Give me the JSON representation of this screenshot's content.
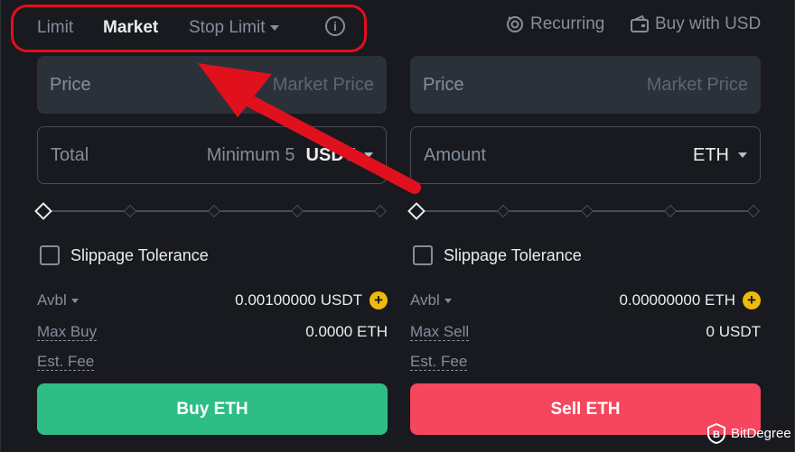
{
  "header": {
    "tabs": [
      {
        "label": "Limit",
        "active": false
      },
      {
        "label": "Market",
        "active": true
      },
      {
        "label": "Stop Limit",
        "active": false
      }
    ],
    "info_icon": "info-circle-icon",
    "recurring_label": "Recurring",
    "buy_with_usd_label": "Buy with USD"
  },
  "buy": {
    "price_label": "Price",
    "price_placeholder": "Market Price",
    "total_label": "Total",
    "total_min": "Minimum 5",
    "total_unit": "USDT",
    "slippage_label": "Slippage Tolerance",
    "avbl_label": "Avbl",
    "avbl_value": "0.00100000 USDT",
    "max_label": "Max Buy",
    "max_value": "0.0000 ETH",
    "fee_label": "Est. Fee",
    "button_label": "Buy ETH"
  },
  "sell": {
    "price_label": "Price",
    "price_placeholder": "Market Price",
    "amount_label": "Amount",
    "amount_unit": "ETH",
    "slippage_label": "Slippage Tolerance",
    "avbl_label": "Avbl",
    "avbl_value": "0.00000000 ETH",
    "max_label": "Max Sell",
    "max_value": "0 USDT",
    "fee_label": "Est. Fee",
    "button_label": "Sell ETH"
  },
  "colors": {
    "background": "#181a20",
    "buy": "#2ebd85",
    "sell": "#f6465d",
    "accent": "#f0b90b",
    "annotation": "#e0101d"
  },
  "watermark": "BitDegree"
}
